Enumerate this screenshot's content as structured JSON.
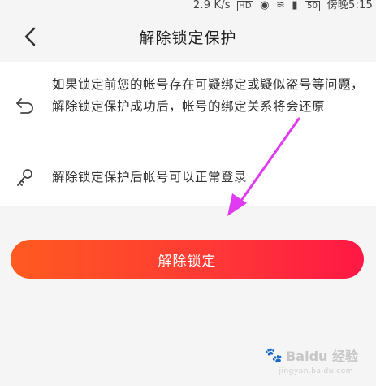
{
  "status_bar": {
    "speed": "2.9 K/s",
    "time": "傍晚5:15",
    "battery": "50"
  },
  "header": {
    "title": "解除锁定保护"
  },
  "info": {
    "row_1": "如果锁定前您的帐号存在可疑绑定或疑似盗号等问题，解除锁定保护成功后，帐号的绑定关系将会还原",
    "row_2": "解除锁定保护后帐号可以正常登录"
  },
  "action": {
    "unlock_label": "解除锁定"
  },
  "watermark": {
    "brand": "Baidu 经验",
    "site": "jingyan.baidu.com"
  },
  "colors": {
    "button_start": "#ff5a1f",
    "button_end": "#ff1845",
    "annotation_arrow": "#e03bf0"
  },
  "icons": {
    "back": "chevron-left-icon",
    "undo": "undo-arrow-icon",
    "key": "key-icon"
  }
}
